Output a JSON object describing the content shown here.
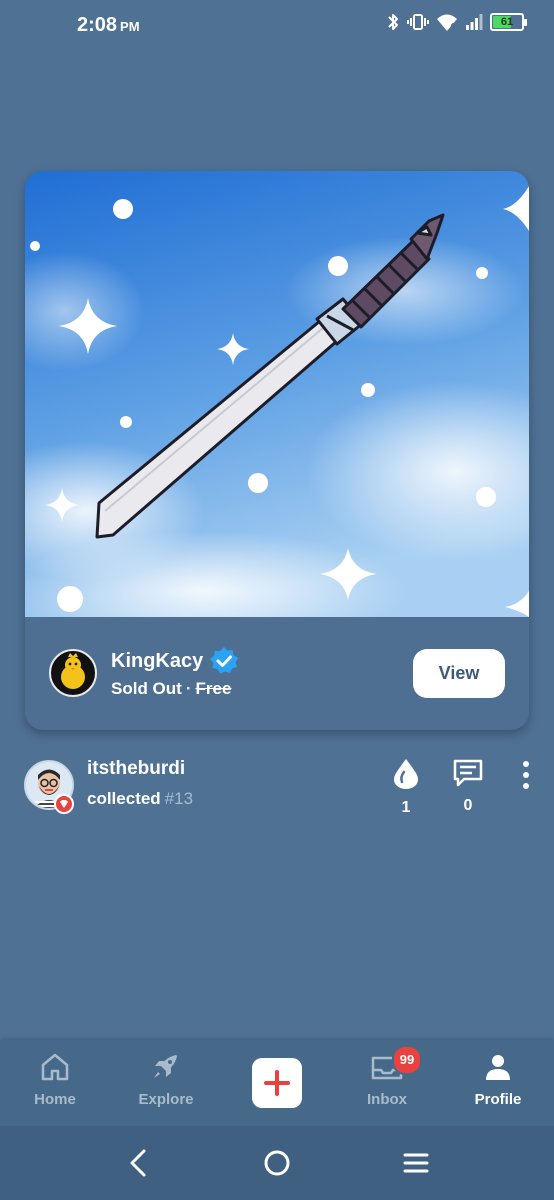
{
  "status_bar": {
    "time": "2:08",
    "ampm": "PM",
    "battery": "61",
    "colors": {
      "battery_fill": "#4cd964"
    }
  },
  "post": {
    "creator": {
      "name": "KingKacy",
      "verified": true,
      "verified_icon": "verified-badge-icon",
      "avatar": "chick-avatar"
    },
    "price": {
      "status": "Sold Out",
      "separator": "·",
      "original": "Free"
    },
    "view_label": "View",
    "image": {
      "subject": "katana-sword",
      "background": "blue-sky-with-sparkles"
    }
  },
  "activity": {
    "user": "itstheburdi",
    "action": "collected",
    "edition": "#13",
    "likes": "1",
    "comments": "0",
    "icons": {
      "like": "flame-icon",
      "comment": "comment-icon",
      "more": "more-vertical-icon"
    }
  },
  "tab_bar": {
    "tabs": [
      {
        "label": "Home",
        "icon": "home-icon",
        "active": false
      },
      {
        "label": "Explore",
        "icon": "rocket-icon",
        "active": false
      },
      {
        "label": "",
        "icon": "plus-icon",
        "active": false
      },
      {
        "label": "Inbox",
        "icon": "inbox-icon",
        "active": false,
        "badge": "99"
      },
      {
        "label": "Profile",
        "icon": "person-icon",
        "active": true
      }
    ]
  },
  "colors": {
    "background": "#4f7194",
    "accent_red": "#e9413e",
    "muted_text": "#a8bbcd"
  }
}
